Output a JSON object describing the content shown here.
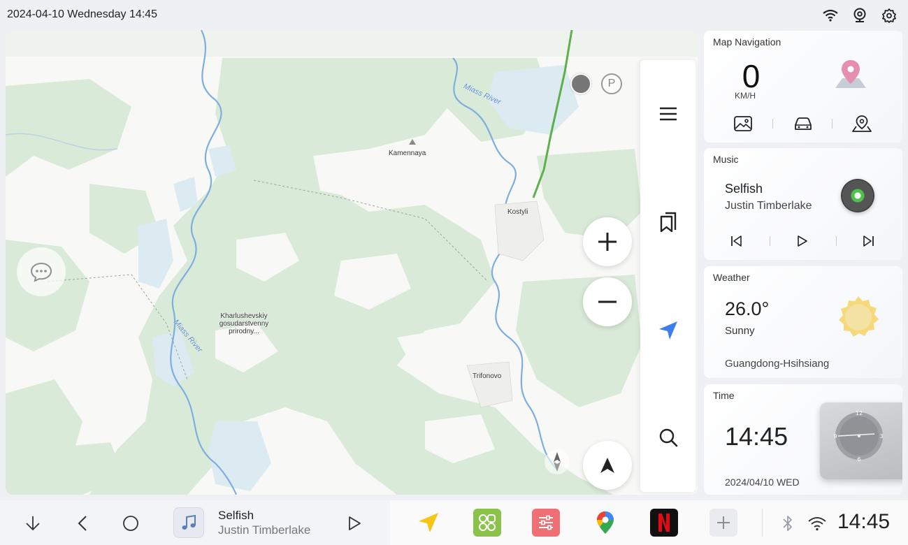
{
  "status_bar": {
    "datetime": "2024-04-10 Wednesday 14:45",
    "icons": [
      "wifi-icon",
      "webcam-icon",
      "settings-icon"
    ]
  },
  "map": {
    "labels": {
      "kamennaya": "Kamennaya",
      "kostyli": "Kostyli",
      "trifonovo": "Trifonovo",
      "reserve": "Kharlushevskiy gosudarstvenny prirodny...",
      "river_top": "Miass River",
      "river_left": "Miass River"
    },
    "parking_label": "P",
    "sidebar_icons": [
      "menu-icon",
      "bookmarks-icon",
      "navigate-icon",
      "search-icon"
    ]
  },
  "nav_card": {
    "title": "Map Navigation",
    "speed": "0",
    "unit": "KM/H",
    "icons": [
      "photo-icon",
      "car-icon",
      "location-icon"
    ]
  },
  "music_card": {
    "title": "Music",
    "song": "Selfish",
    "artist": "Justin Timberlake",
    "controls": [
      "previous-icon",
      "play-icon",
      "next-icon"
    ]
  },
  "weather_card": {
    "title": "Weather",
    "temperature": "26.0°",
    "condition": "Sunny",
    "location": "Guangdong-Hsihsiang"
  },
  "time_card": {
    "title": "Time",
    "time": "14:45",
    "date": "2024/04/10 WED",
    "dial_numbers": {
      "top": "12",
      "right": "3",
      "bottom": "6",
      "left": "9"
    }
  },
  "dock": {
    "song": "Selfish",
    "artist": "Justin Timberlake",
    "clock": "14:45",
    "colors": {
      "nav_app": "#f5c518",
      "green_app": "#8bc34a",
      "red_app": "#ef6f75",
      "netflix_bg": "#111111",
      "netflix_letter": "#e50914"
    }
  }
}
